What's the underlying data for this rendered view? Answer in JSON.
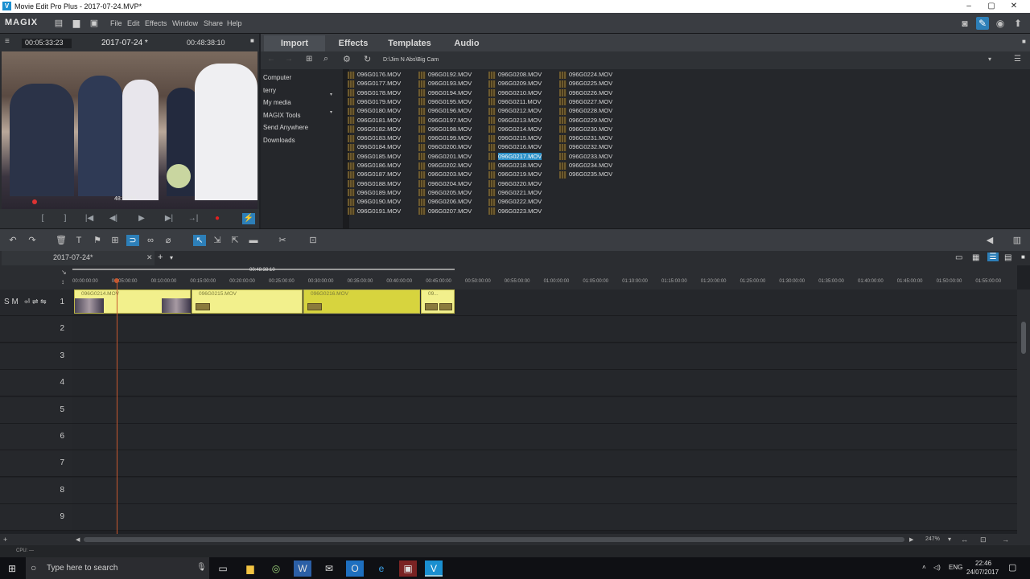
{
  "window": {
    "title": "Movie Edit Pro Plus - 2017-07-24.MVP*",
    "app_icon": "V"
  },
  "menubar": {
    "logo": "MAGIX",
    "items": [
      "File",
      "Edit",
      "Effects",
      "Window",
      "Share",
      "Help"
    ]
  },
  "monitor": {
    "timecode_left": "00:05:33:23",
    "project_date": "2017-07-24 *",
    "timecode_right": "00:48:38:10",
    "overlay_time": "48:38:10"
  },
  "browser": {
    "tabs": [
      "Import",
      "Effects",
      "Templates",
      "Audio"
    ],
    "active_tab": "Import",
    "path": "D:\\Jim N Abs\\Big Cam",
    "nav": [
      "Computer",
      "terry",
      "My media",
      "MAGIX Tools",
      "Send Anywhere",
      "Downloads"
    ],
    "columns": [
      [
        "096G0176.MOV",
        "096G0177.MOV",
        "096G0178.MOV",
        "096G0179.MOV",
        "096G0180.MOV",
        "096G0181.MOV",
        "096G0182.MOV",
        "096G0183.MOV",
        "096G0184.MOV",
        "096G0185.MOV",
        "096G0186.MOV",
        "096G0187.MOV",
        "096G0188.MOV",
        "096G0189.MOV",
        "096G0190.MOV",
        "096G0191.MOV"
      ],
      [
        "096G0192.MOV",
        "096G0193.MOV",
        "096G0194.MOV",
        "096G0195.MOV",
        "096G0196.MOV",
        "096G0197.MOV",
        "096G0198.MOV",
        "096G0199.MOV",
        "096G0200.MOV",
        "096G0201.MOV",
        "096G0202.MOV",
        "096G0203.MOV",
        "096G0204.MOV",
        "096G0205.MOV",
        "096G0206.MOV",
        "096G0207.MOV"
      ],
      [
        "096G0208.MOV",
        "096G0209.MOV",
        "096G0210.MOV",
        "096G0211.MOV",
        "096G0212.MOV",
        "096G0213.MOV",
        "096G0214.MOV",
        "096G0215.MOV",
        "096G0216.MOV",
        "096G0217.MOV",
        "096G0218.MOV",
        "096G0219.MOV",
        "096G0220.MOV",
        "096G0221.MOV",
        "096G0222.MOV",
        "096G0223.MOV"
      ],
      [
        "096G0224.MOV",
        "096G0225.MOV",
        "096G0226.MOV",
        "096G0227.MOV",
        "096G0228.MOV",
        "096G0229.MOV",
        "096G0230.MOV",
        "096G0231.MOV",
        "096G0232.MOV",
        "096G0233.MOV",
        "096G0234.MOV",
        "096G0235.MOV"
      ]
    ],
    "selected_file": "096G0217.MOV"
  },
  "timeline": {
    "project_tab": "2017-07-24*",
    "marker_time": "00:48:38:10",
    "ruler": [
      "00:00:00:00",
      "00:05:00:00",
      "00:10:00:00",
      "00:15:00:00",
      "00:20:00:00",
      "00:25:00:00",
      "00:30:00:00",
      "00:35:00:00",
      "00:40:00:00",
      "00:45:00:00",
      "00:50:00:00",
      "00:55:00:00",
      "01:00:00:00",
      "01:05:00:00",
      "01:10:00:00",
      "01:15:00:00",
      "01:20:00:00",
      "01:25:00:00",
      "01:30:00:00",
      "01:35:00:00",
      "01:40:00:00",
      "01:45:00:00",
      "01:50:00:00",
      "01:55:00:00"
    ],
    "track_numbers": [
      "1",
      "2",
      "3",
      "4",
      "5",
      "6",
      "7",
      "8",
      "9"
    ],
    "track_header_label": "S M",
    "clips": [
      "096G0214.MOV",
      "096G0215.MOV",
      "096G0216.MOV",
      "09..."
    ],
    "zoom": "247%"
  },
  "status": {
    "cpu": "CPU: —"
  },
  "taskbar": {
    "search_placeholder": "Type here to search",
    "lang": "ENG",
    "time": "22:46",
    "date": "24/07/2017"
  }
}
